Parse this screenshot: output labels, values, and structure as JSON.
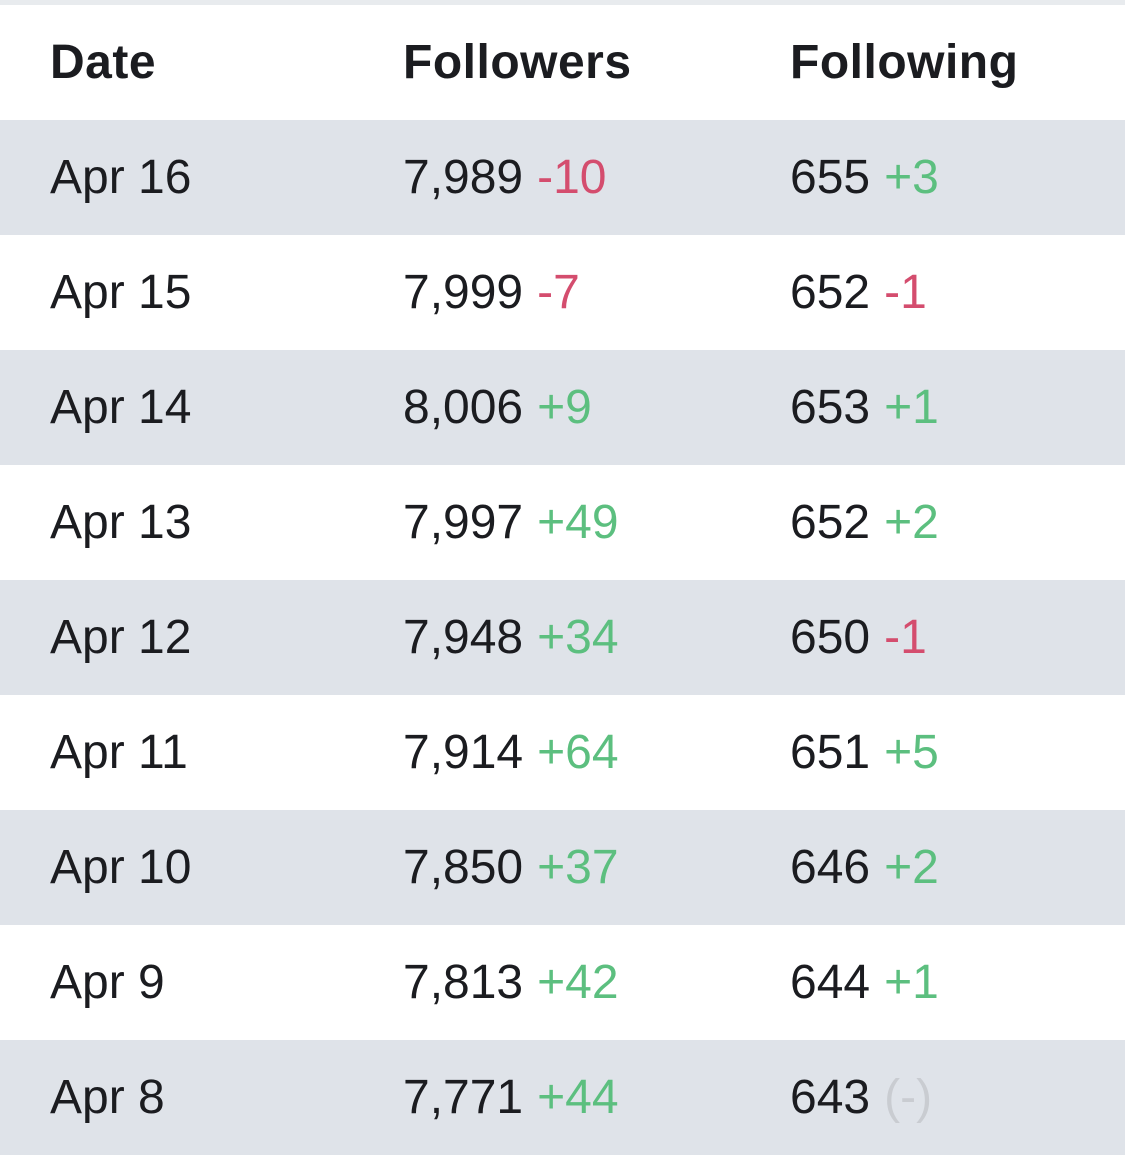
{
  "headers": {
    "date": "Date",
    "followers": "Followers",
    "following": "Following"
  },
  "colors": {
    "positive": "#5cbf7f",
    "negative": "#d44d6e",
    "neutral": "#c9ccd1",
    "stripe": "#dfe3e9"
  },
  "rows": [
    {
      "date": "Apr 16",
      "followers": "7,989",
      "followers_delta": "-10",
      "followers_trend": "neg",
      "following": "655",
      "following_delta": "+3",
      "following_trend": "pos"
    },
    {
      "date": "Apr 15",
      "followers": "7,999",
      "followers_delta": "-7",
      "followers_trend": "neg",
      "following": "652",
      "following_delta": "-1",
      "following_trend": "neg"
    },
    {
      "date": "Apr 14",
      "followers": "8,006",
      "followers_delta": "+9",
      "followers_trend": "pos",
      "following": "653",
      "following_delta": "+1",
      "following_trend": "pos"
    },
    {
      "date": "Apr 13",
      "followers": "7,997",
      "followers_delta": "+49",
      "followers_trend": "pos",
      "following": "652",
      "following_delta": "+2",
      "following_trend": "pos"
    },
    {
      "date": "Apr 12",
      "followers": "7,948",
      "followers_delta": "+34",
      "followers_trend": "pos",
      "following": "650",
      "following_delta": "-1",
      "following_trend": "neg"
    },
    {
      "date": "Apr 11",
      "followers": "7,914",
      "followers_delta": "+64",
      "followers_trend": "pos",
      "following": "651",
      "following_delta": "+5",
      "following_trend": "pos"
    },
    {
      "date": "Apr 10",
      "followers": "7,850",
      "followers_delta": "+37",
      "followers_trend": "pos",
      "following": "646",
      "following_delta": "+2",
      "following_trend": "pos"
    },
    {
      "date": "Apr 9",
      "followers": "7,813",
      "followers_delta": "+42",
      "followers_trend": "pos",
      "following": "644",
      "following_delta": "+1",
      "following_trend": "pos"
    },
    {
      "date": "Apr 8",
      "followers": "7,771",
      "followers_delta": "+44",
      "followers_trend": "pos",
      "following": "643",
      "following_delta": "(-)",
      "following_trend": "none"
    }
  ]
}
